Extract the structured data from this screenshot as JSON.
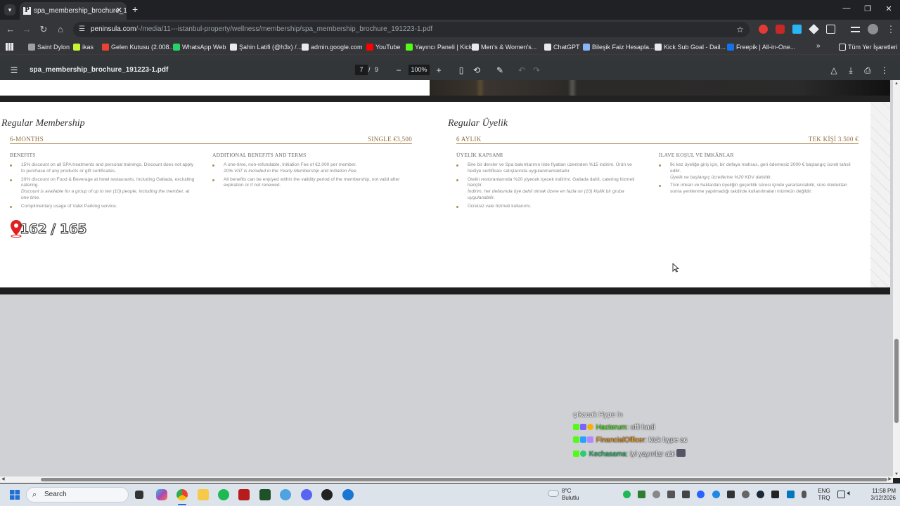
{
  "browser": {
    "tab_title": "spa_membership_brochure_191",
    "tab_favicon": "P",
    "url_host": "peninsula.com",
    "url_path": "/-/media/11---istanbul-property/wellness/membership/spa_membership_brochure_191223-1.pdf"
  },
  "bookmarks": [
    {
      "label": "Saint Dylon",
      "icon": "bookmark-icon",
      "color": "#9aa0a6"
    },
    {
      "label": "ikas",
      "icon": "ikas-icon",
      "color": "#c6f432"
    },
    {
      "label": "Gelen Kutusu (2.008...",
      "icon": "gmail-icon",
      "color": "#ea4335"
    },
    {
      "label": "WhatsApp Web",
      "icon": "whatsapp-icon",
      "color": "#25d366"
    },
    {
      "label": "Şahin Latifi (@h3x) /...",
      "icon": "x-icon",
      "color": "#e8eaed"
    },
    {
      "label": "admin.google.com",
      "icon": "google-icon",
      "color": "#e8eaed"
    },
    {
      "label": "YouTube",
      "icon": "youtube-icon",
      "color": "#ff0000"
    },
    {
      "label": "Yayıncı Paneli | Kick",
      "icon": "kick-icon",
      "color": "#53fc18"
    },
    {
      "label": "Men's & Women's...",
      "icon": "site-icon",
      "color": "#e8eaed"
    },
    {
      "label": "ChatGPT",
      "icon": "chatgpt-icon",
      "color": "#e8eaed"
    },
    {
      "label": "Bileşik Faiz Hesapla...",
      "icon": "site-icon",
      "color": "#8ab4f8"
    },
    {
      "label": "Kick Sub Goal - Dail...",
      "icon": "grid-icon",
      "color": "#e8eaed"
    },
    {
      "label": "Freepik | All-in-One...",
      "icon": "freepik-icon",
      "color": "#1273eb"
    }
  ],
  "all_bookmarks_label": "Tüm Yer İşaretleri",
  "pdf": {
    "filename": "spa_membership_brochure_191223-1.pdf",
    "page_current": "7",
    "page_sep": "/",
    "page_total": "9",
    "zoom": "100%"
  },
  "english": {
    "title": "Regular Membership",
    "duration": "6-MONTHS",
    "price": "SINGLE €3,500",
    "benefits_head": "BENEFITS",
    "benefits": [
      "15% discount on all SPA treatments and personal trainings. Discount does not apply to purchase of any products or gift certificates.",
      "20% discount on Food & Beverage at hotel restaurants, Including Gallada, excluding catering.",
      "Complimentary usage of Valet Parking service."
    ],
    "benefits_note": "Discount is available for a group of up to ten (10) people, including the member, at one time.",
    "additional_head": "ADDITIONAL BENEFITS AND TERMS",
    "additional": [
      "A one-time, non-refundable, Initiation Fee of €2,000 per member.",
      "All benefits can be enjoyed within the validity period of the membership, not valid after expiration or if not renewed."
    ],
    "additional_note": "20% VAT is included in the Yearly Membership and Initiation Fee."
  },
  "turkish": {
    "title": "Regular Üyelik",
    "duration": "6 AYLIK",
    "price": "TEK KİŞİ 3.500 €",
    "benefits_head": "ÜYELİK KAPSAMI",
    "benefits": [
      "Bire bir dersler ve Spa bakımlarının liste fiyatları üzerinden %15 indirim. Ürün ve hediye sertifikası satışlarında uygulanmamaktadır.",
      "Otelin restoranlarında %20 yiyecek içecek indirimi. Gallada dahil, catering hizmeti hariçtir.",
      "Ücretsiz vale hizmeti kullanımı."
    ],
    "benefits_note": "İndirim, her defasında üye dahil olmak üzere en fazla on (10) kişilik bir gruba uygulanabilir.",
    "additional_head": "İLAVE KOŞUL VE İMKÂNLAR",
    "additional": [
      "İki kez üyeliğe giriş için, bir defaya mahsus, geri ödemesiz 2000 € başlangıç ücreti tahsil edilir.",
      "Tüm imkan ve haklardan üyeliğin geçerlilik süresi içinde yararlanılabilir, süre dolduktan sonra yenilenme yapılmadığı takdirde kullanılmaları mümkün değildir."
    ],
    "additional_note": "Üyelik ve başlangıç ücretlerine %20 KDV dahildir."
  },
  "overlay_counter": "162 / 165",
  "chat": [
    {
      "user": "",
      "message": "çıkacak Hype in",
      "color": "#ffffff"
    },
    {
      "user": "Hacterum",
      "message": ": offi hadi",
      "color": "#53fc18"
    },
    {
      "user": "FinancialOfficer",
      "message": ": kick hype ac",
      "color": "#ff9f1c"
    },
    {
      "user": "Kechasama",
      "message": ": iyi yayınlar abi",
      "color": "#2ecc71"
    }
  ],
  "taskbar": {
    "search_placeholder": "Search",
    "weather_temp": "8°C",
    "weather_desc": "Bulutlu",
    "lang1": "ENG",
    "lang2": "TRQ",
    "time": "11:58 PM",
    "date": "3/12/2026"
  }
}
